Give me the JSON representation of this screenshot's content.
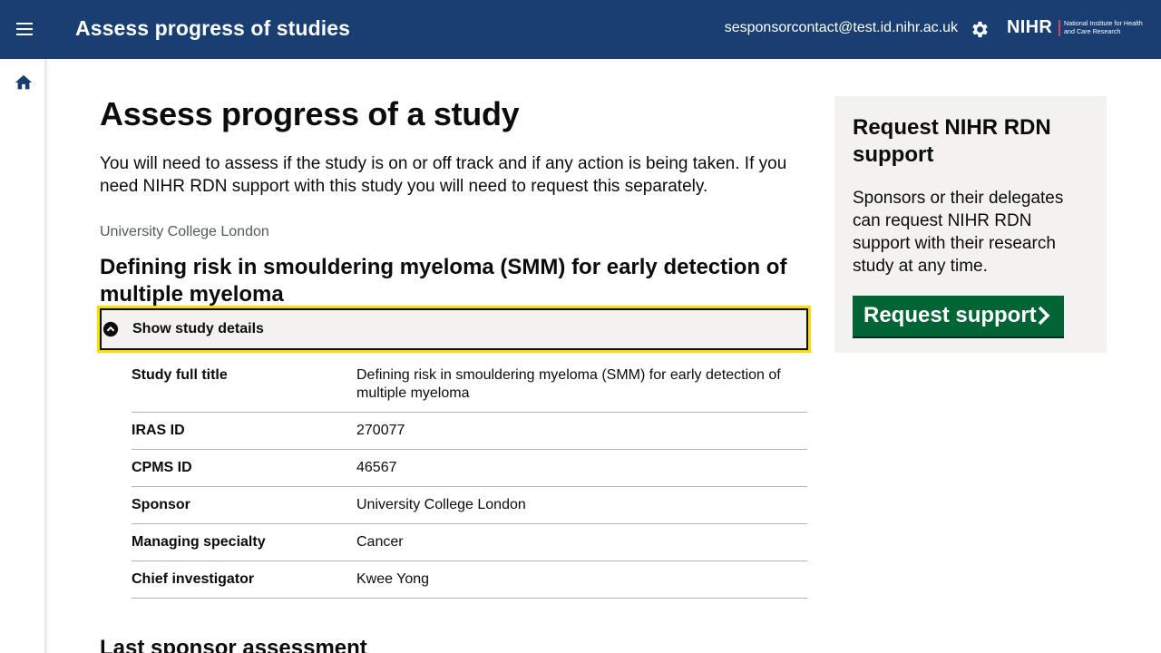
{
  "header": {
    "title": "Assess progress of studies",
    "user_email": "sesponsorcontact@test.id.nihr.ac.uk",
    "logo_text": "NIHR",
    "logo_subtext": "National Institute for Health and Care Research",
    "menu_icon": "menu-icon",
    "settings_icon": "gear-icon"
  },
  "sidebar": {
    "home_icon": "home-icon"
  },
  "main": {
    "title": "Assess progress of a study",
    "lead": "You will need to assess if the study is on or off track and if any action is being taken. If you need NIHR RDN support with this study you will need to request this separately.",
    "organisation": "University College London",
    "study_title": "Defining risk in smouldering myeloma (SMM) for early detection of multiple myeloma",
    "details_toggle_label": "Show study details",
    "details": [
      {
        "key": "Study full title",
        "value": "Defining risk in smouldering myeloma (SMM) for early detection of multiple myeloma"
      },
      {
        "key": "IRAS ID",
        "value": "270077"
      },
      {
        "key": "CPMS ID",
        "value": "46567"
      },
      {
        "key": "Sponsor",
        "value": "University College London"
      },
      {
        "key": "Managing specialty",
        "value": "Cancer"
      },
      {
        "key": "Chief investigator",
        "value": "Kwee Yong"
      }
    ],
    "next_heading": "Last sponsor assessment"
  },
  "aside": {
    "title": "Request NIHR RDN support",
    "body": "Sponsors or their delegates can request NIHR RDN support with their research study at any time.",
    "button_label": "Request support"
  },
  "colors": {
    "header_bg": "#193e72",
    "button_green": "#006435",
    "focus_yellow": "#ffdd00",
    "panel_grey": "#f3f2f1"
  }
}
